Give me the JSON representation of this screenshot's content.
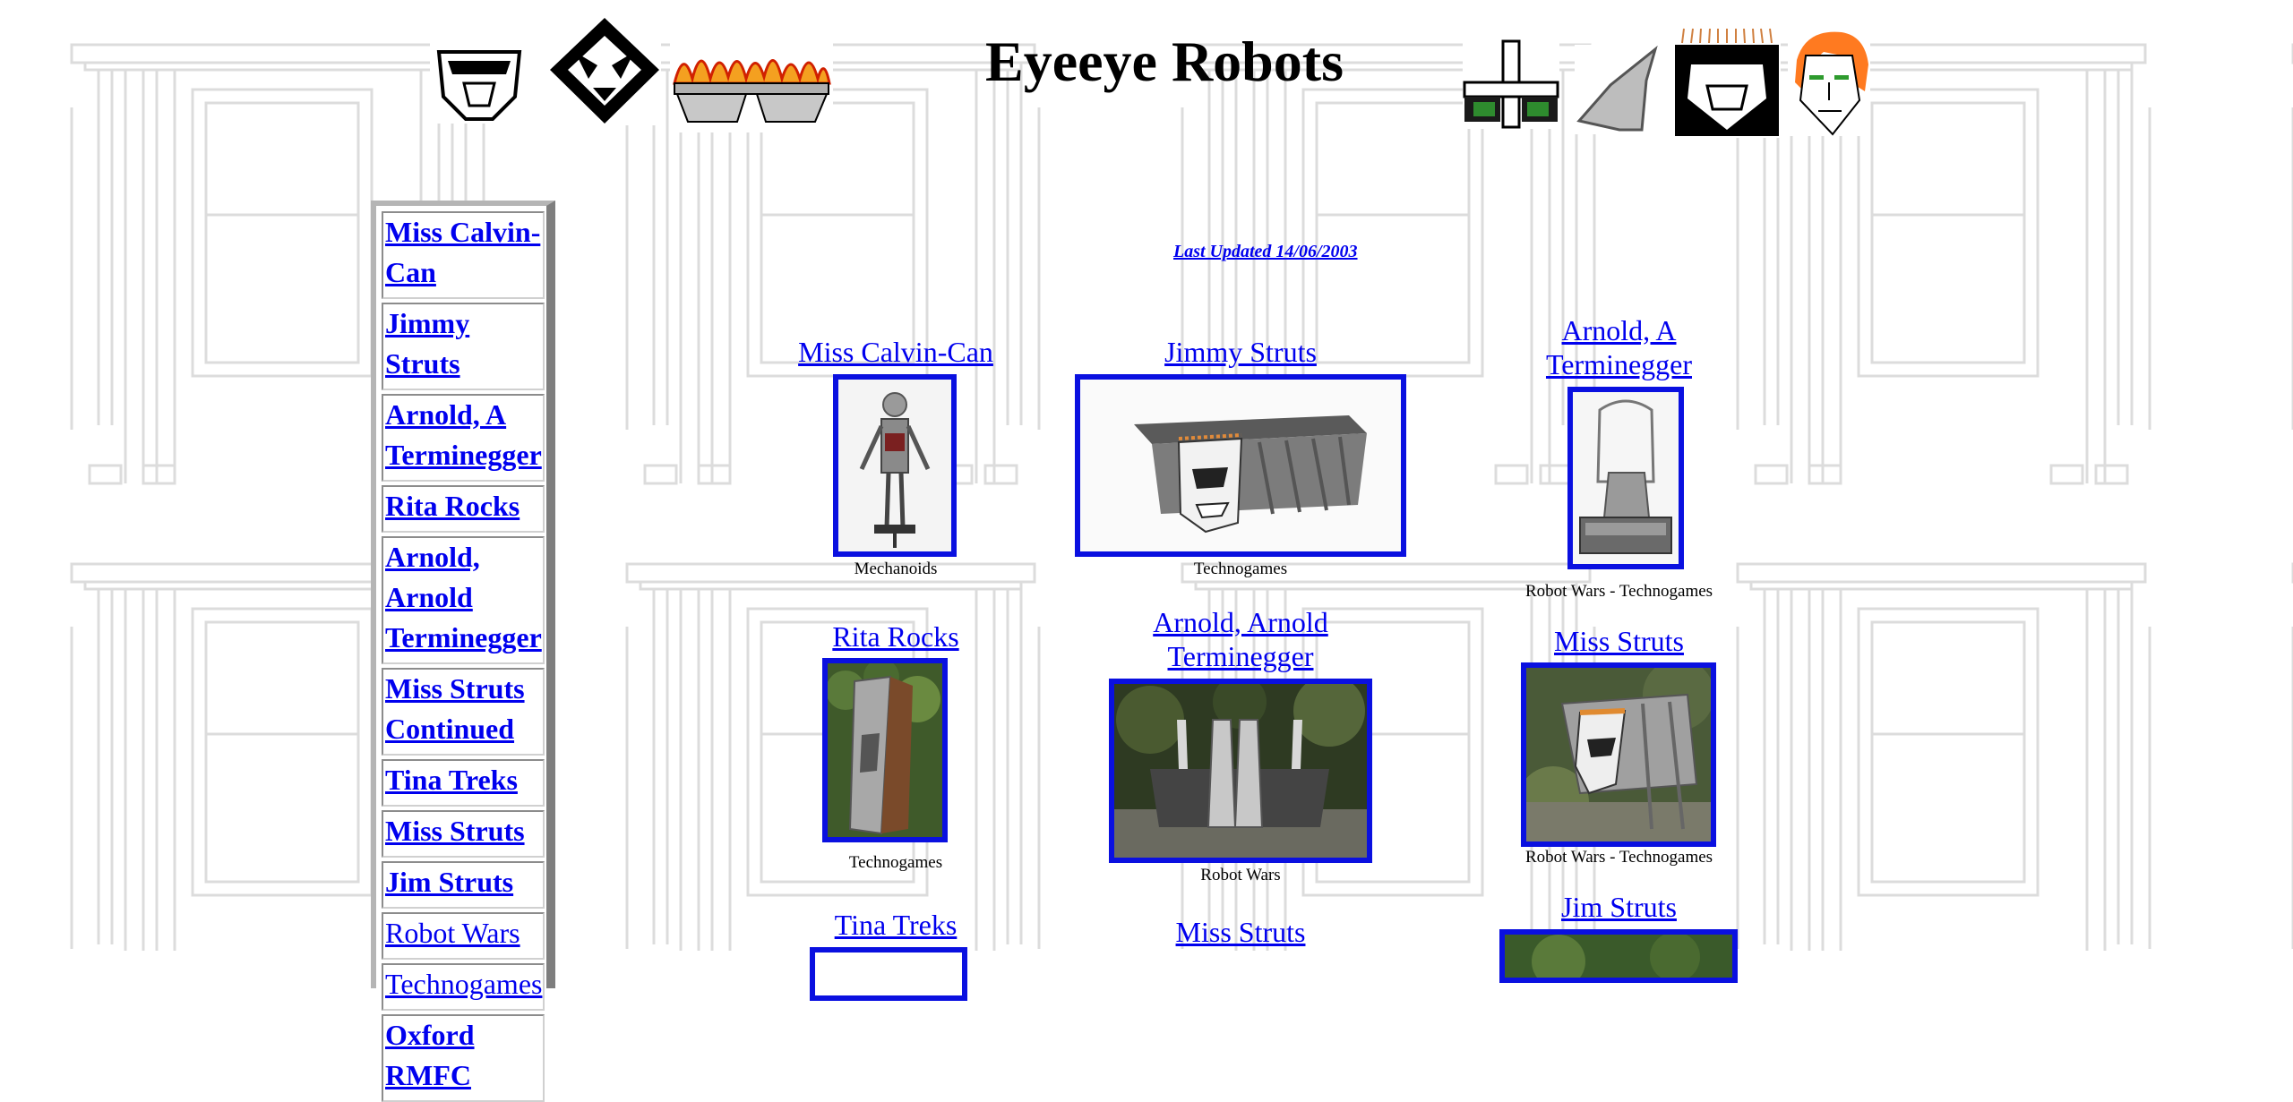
{
  "header": {
    "title": "Eyeeye Robots",
    "left_icons": [
      "robot-face-mask-icon",
      "robot-face-diamond-icon",
      "flame-robot-icon"
    ],
    "right_icons": [
      "strut-robot-icon",
      "wedge-robot-icon",
      "spiky-hair-robot-icon",
      "orange-hair-face-icon"
    ]
  },
  "sidebar": {
    "items": [
      {
        "label": "Miss Calvin-Can",
        "bold": true
      },
      {
        "label": "Jimmy Struts",
        "bold": true
      },
      {
        "label": "Arnold, A Terminegger",
        "bold": true
      },
      {
        "label": "Rita Rocks",
        "bold": true
      },
      {
        "label": "Arnold, Arnold Terminegger",
        "bold": true
      },
      {
        "label": "Miss Struts Continued",
        "bold": true
      },
      {
        "label": "Tina Treks",
        "bold": true
      },
      {
        "label": "Miss Struts",
        "bold": true
      },
      {
        "label": "Jim Struts",
        "bold": true
      },
      {
        "label": "Robot Wars",
        "bold": false
      },
      {
        "label": "Technogames",
        "bold": false
      },
      {
        "label": "Oxford RMFC",
        "bold": true
      }
    ]
  },
  "main": {
    "last_updated": "Last Updated 14/06/2003",
    "robots": [
      {
        "name": "Miss Calvin-Can",
        "caption": "Mechanoids"
      },
      {
        "name": "Jimmy Struts",
        "caption": "Technogames"
      },
      {
        "name": "Arnold, A Terminegger",
        "caption": "Robot Wars - Technogames"
      },
      {
        "name": "Rita Rocks",
        "caption": "Technogames"
      },
      {
        "name": "Arnold, Arnold Terminegger",
        "caption": "Robot Wars"
      },
      {
        "name": "Miss Struts",
        "caption": "Robot Wars - Technogames"
      },
      {
        "name": "Tina Treks",
        "caption": ""
      },
      {
        "name": "Miss Struts",
        "caption": ""
      },
      {
        "name": "Jim Struts",
        "caption": ""
      }
    ]
  },
  "colors": {
    "link": "#0000ee",
    "photo_border": "#0a10e0",
    "background_pattern": "#d8d8d8"
  }
}
